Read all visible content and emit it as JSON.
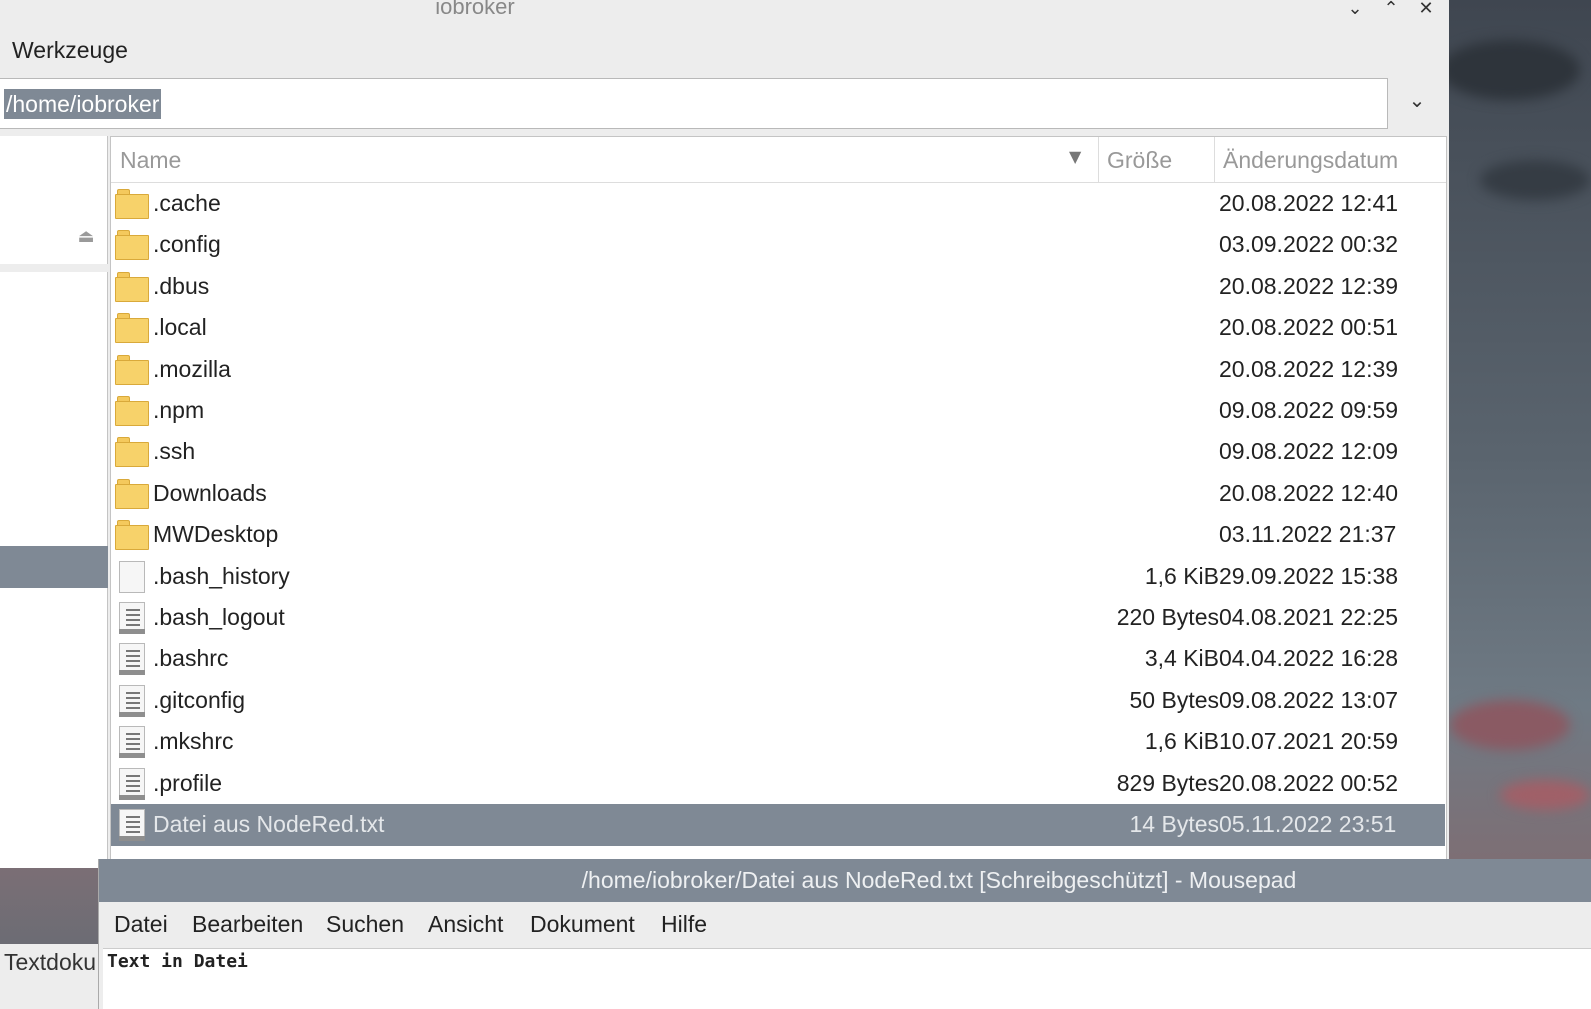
{
  "file_manager": {
    "window_title": "iobroker",
    "window_controls": {
      "minimize": "⌄",
      "maximize": "⌃",
      "close": "✕"
    },
    "menu": {
      "tools_label": "Werkzeuge"
    },
    "path": {
      "value": "/home/iobroker"
    },
    "columns": {
      "name": "Name",
      "size": "Größe",
      "modified": "Änderungsdatum"
    },
    "files": [
      {
        "name": ".cache",
        "size": "",
        "modified": "20.08.2022 12:41",
        "icon": "folder-icon"
      },
      {
        "name": ".config",
        "size": "",
        "modified": "03.09.2022 00:32",
        "icon": "folder-icon"
      },
      {
        "name": ".dbus",
        "size": "",
        "modified": "20.08.2022 12:39",
        "icon": "folder-icon"
      },
      {
        "name": ".local",
        "size": "",
        "modified": "20.08.2022 00:51",
        "icon": "folder-icon"
      },
      {
        "name": ".mozilla",
        "size": "",
        "modified": "20.08.2022 12:39",
        "icon": "folder-icon"
      },
      {
        "name": ".npm",
        "size": "",
        "modified": "09.08.2022 09:59",
        "icon": "folder-icon"
      },
      {
        "name": ".ssh",
        "size": "",
        "modified": "09.08.2022 12:09",
        "icon": "folder-icon"
      },
      {
        "name": "Downloads",
        "size": "",
        "modified": "20.08.2022 12:40",
        "icon": "folder-icon"
      },
      {
        "name": "MWDesktop",
        "size": "",
        "modified": "03.11.2022 21:37",
        "icon": "folder-icon"
      },
      {
        "name": ".bash_history",
        "size": "1,6 KiB",
        "modified": "29.09.2022 15:38",
        "icon": "blank-file-icon"
      },
      {
        "name": ".bash_logout",
        "size": "220 Bytes",
        "modified": "04.08.2021 22:25",
        "icon": "text-file-icon"
      },
      {
        "name": ".bashrc",
        "size": "3,4 KiB",
        "modified": "04.04.2022 16:28",
        "icon": "text-file-icon"
      },
      {
        "name": ".gitconfig",
        "size": "50 Bytes",
        "modified": "09.08.2022 13:07",
        "icon": "text-file-icon"
      },
      {
        "name": ".mkshrc",
        "size": "1,6 KiB",
        "modified": "10.07.2021 20:59",
        "icon": "text-file-icon"
      },
      {
        "name": ".profile",
        "size": "829 Bytes",
        "modified": "20.08.2022 00:52",
        "icon": "text-file-icon"
      },
      {
        "name": "Datei aus NodeRed.txt",
        "size": "14 Bytes",
        "modified": "05.11.2022 23:51",
        "icon": "text-file-icon",
        "selected": true
      }
    ],
    "status_text": "Textdoku"
  },
  "mousepad": {
    "title": "/home/iobroker/Datei aus NodeRed.txt [Schreibgeschützt] - Mousepad",
    "menu": [
      "Datei",
      "Bearbeiten",
      "Suchen",
      "Ansicht",
      "Dokument",
      "Hilfe"
    ],
    "content": "Text in Datei"
  },
  "colors": {
    "selection": "#7f8995",
    "folder": "#f7d26a"
  }
}
